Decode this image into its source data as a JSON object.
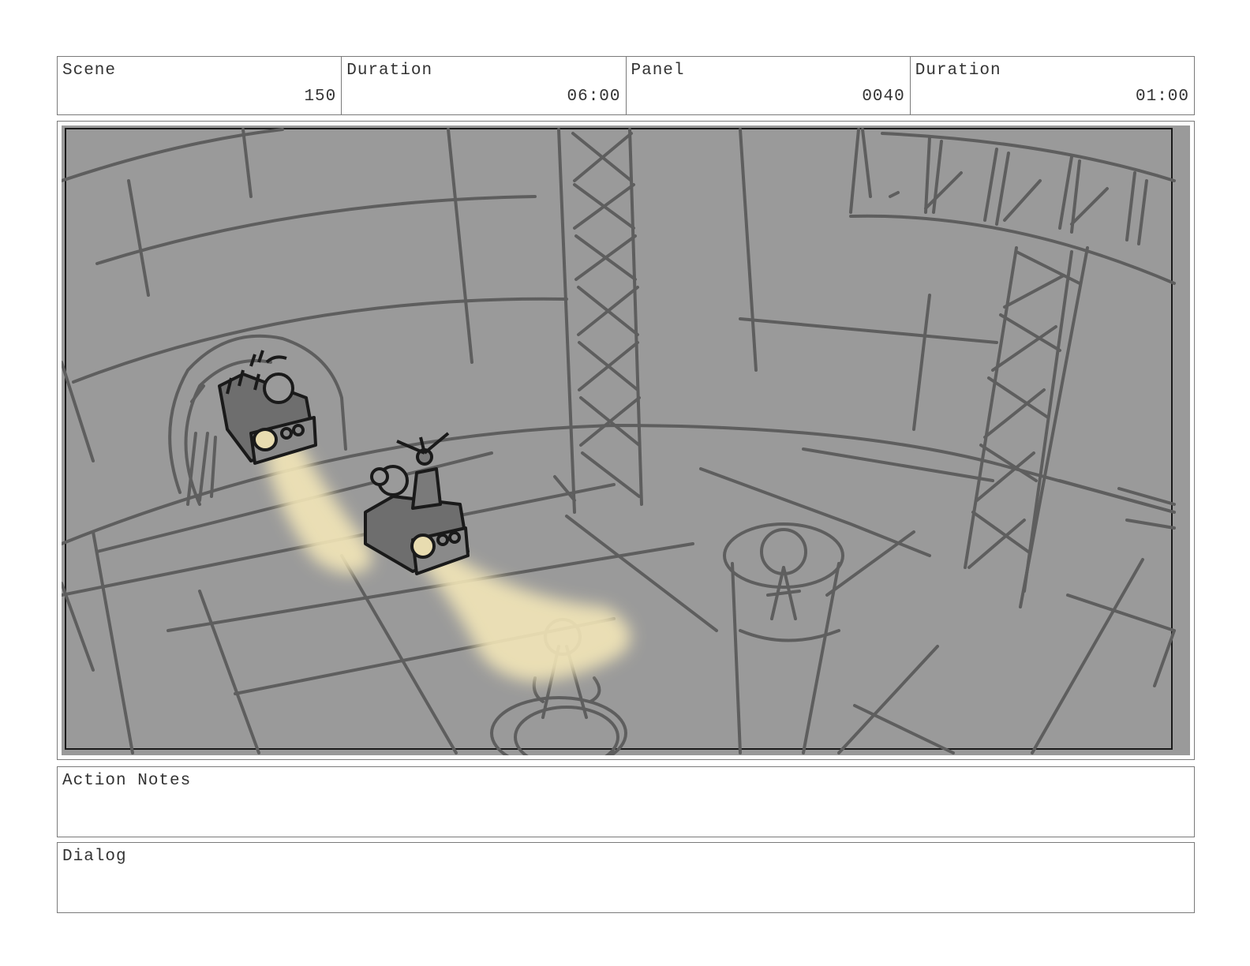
{
  "header": {
    "scene": {
      "label": "Scene",
      "value": "150"
    },
    "scene_duration": {
      "label": "Duration",
      "value": "06:00"
    },
    "panel": {
      "label": "Panel",
      "value": "0040"
    },
    "panel_duration": {
      "label": "Duration",
      "value": "01:00"
    }
  },
  "notes": {
    "action_label": "Action Notes",
    "dialog_label": "Dialog"
  },
  "colors": {
    "panel_background": "#9a9a9a",
    "sketch_lines": "#5a5a5a",
    "ink": "#1a1a1a",
    "headlight_glow": "#f3e6b8"
  }
}
